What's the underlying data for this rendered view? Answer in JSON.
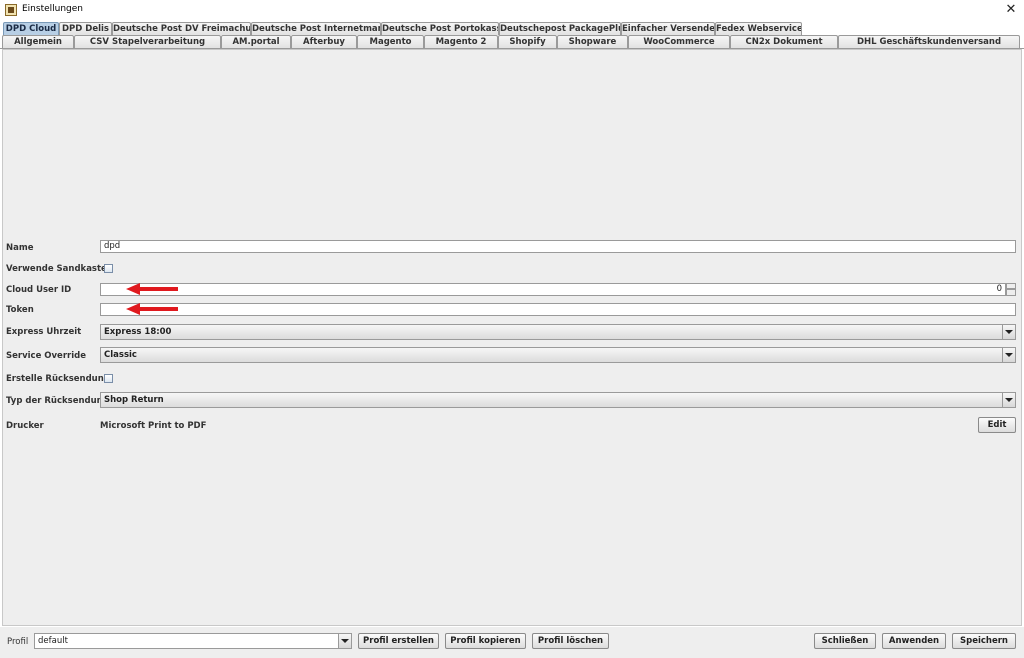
{
  "window": {
    "title": "Einstellungen",
    "close_glyph": "✕"
  },
  "tabs": {
    "row1": [
      "DPD Cloud",
      "DPD Delis",
      "Deutsche Post DV Freimachung",
      "Deutsche Post Internetmarke",
      "Deutsche Post Portokasse",
      "Deutschepost PackagePlus",
      "Einfacher Versender",
      "Fedex Webservice"
    ],
    "row2": [
      "Allgemein",
      "CSV Stapelverarbeitung",
      "AM.portal",
      "Afterbuy",
      "Magento",
      "Magento 2",
      "Shopify",
      "Shopware",
      "WooCommerce",
      "CN2x Dokument",
      "DHL Geschäftskundenversand"
    ],
    "selected": "DPD Cloud"
  },
  "form": {
    "name_label": "Name",
    "name_value": "dpd",
    "sandbox_label": "Verwende Sandkasten",
    "cloud_user_id_label": "Cloud User ID",
    "cloud_user_id_value": "0",
    "token_label": "Token",
    "token_value": "",
    "express_label": "Express Uhrzeit",
    "express_value": "Express 18:00",
    "service_override_label": "Service Override",
    "service_override_value": "Classic",
    "return_label": "Erstelle Rücksendung",
    "return_type_label": "Typ der Rücksendung",
    "return_type_value": "Shop Return",
    "printer_label": "Drucker",
    "printer_value": "Microsoft Print to PDF",
    "edit_button": "Edit"
  },
  "annotations": {
    "arrow_color": "#e0191e"
  },
  "bottom": {
    "profile_label": "Profil",
    "profile_value": "default",
    "create_button": "Profil erstellen",
    "copy_button": "Profil kopieren",
    "delete_button": "Profil löschen",
    "close_button": "Schließen",
    "apply_button": "Anwenden",
    "save_button": "Speichern"
  },
  "colors": {
    "selected_tab": "#b8cfe5",
    "panel_bg": "#eeeeee"
  }
}
